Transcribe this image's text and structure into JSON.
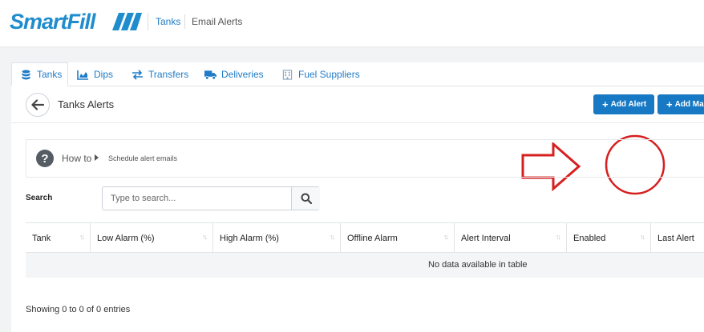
{
  "header": {
    "logo_text": "SmartFill",
    "nav": [
      {
        "label": "Tanks"
      },
      {
        "label": "Email Alerts"
      }
    ]
  },
  "tabs": [
    {
      "label": "Tanks",
      "icon": "database-icon",
      "active": true
    },
    {
      "label": "Dips",
      "icon": "area-chart-icon"
    },
    {
      "label": "Transfers",
      "icon": "exchange-icon"
    },
    {
      "label": "Deliveries",
      "icon": "truck-icon"
    },
    {
      "label": "Fuel Suppliers",
      "icon": "building-icon"
    }
  ],
  "page": {
    "title": "Tanks Alerts",
    "add_alert_label": "Add Alert",
    "add_more_label": "Add Ma"
  },
  "howto": {
    "label": "How to",
    "link": "Schedule alert emails"
  },
  "search": {
    "label": "Search",
    "placeholder": "Type to search...",
    "value": ""
  },
  "table": {
    "columns": [
      "Tank",
      "Low Alarm (%)",
      "High Alarm (%)",
      "Offline Alarm",
      "Alert Interval",
      "Enabled",
      "Last Alert"
    ],
    "empty_text": "No data available in table"
  },
  "footer": {
    "info": "Showing 0 to 0 of 0 entries"
  },
  "colors": {
    "brand_blue": "#1779c4",
    "annotation_red": "#d62020"
  }
}
